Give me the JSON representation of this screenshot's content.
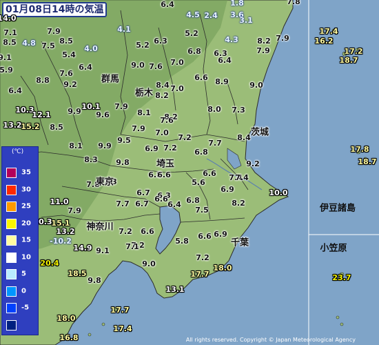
{
  "title": "01月08日14時の気温",
  "copyright": "All rights reserved. Copyright © Japan Meteorological Agency",
  "colors": {
    "sea": "#7fa4c8",
    "land": "#9bbd78",
    "mountain": "#6f9a55",
    "boundary": "#2b2b2b",
    "legend_bg": "#2f3fbf"
  },
  "prefectures": [
    "群馬",
    "栃木",
    "茨城",
    "埼玉",
    "東京",
    "千葉",
    "神奈川"
  ],
  "islands": [
    "伊豆諸島",
    "小笠原"
  ],
  "legend": {
    "unit": "(℃)",
    "items": [
      {
        "label": "35",
        "color": "#b4005a"
      },
      {
        "label": "30",
        "color": "#ff2800"
      },
      {
        "label": "25",
        "color": "#ff9900"
      },
      {
        "label": "20",
        "color": "#faf500"
      },
      {
        "label": "15",
        "color": "#fffaa0"
      },
      {
        "label": "10",
        "color": "#ffffff"
      },
      {
        "label": "5",
        "color": "#b9ebff"
      },
      {
        "label": "0",
        "color": "#0096ff"
      },
      {
        "label": "-5",
        "color": "#0041ff"
      },
      {
        "label": "",
        "color": "#002080"
      }
    ]
  },
  "temps": [
    [
      "14.0"
    ],
    [
      "7.9"
    ],
    [
      "8.5"
    ],
    [
      "6.4"
    ],
    [
      "4.5"
    ],
    [
      "2.4"
    ],
    [
      "1.8"
    ],
    [
      "3.6"
    ],
    [
      "3.1"
    ],
    [
      "7.8"
    ],
    [
      "7.1"
    ],
    [
      "4.1"
    ],
    [
      "6.3"
    ],
    [
      "8.5"
    ],
    [
      "4.8"
    ],
    [
      "7.5"
    ],
    [
      "5.2"
    ],
    [
      "5.2"
    ],
    [
      "6.3"
    ],
    [
      "17.4"
    ],
    [
      "16.2"
    ],
    [
      "7.9"
    ],
    [
      "5.4"
    ],
    [
      "4.0"
    ],
    [
      "6.8"
    ],
    [
      "4.3"
    ],
    [
      "8.2"
    ],
    [
      "7.9"
    ],
    [
      "6.4"
    ],
    [
      "17.2"
    ],
    [
      "18.7"
    ],
    [
      "9.1"
    ],
    [
      "9.0"
    ],
    [
      "7.6"
    ],
    [
      "7.0"
    ],
    [
      "6.4"
    ],
    [
      "5.9"
    ],
    [
      "7.6"
    ],
    [
      "9.2"
    ],
    [
      "8.8"
    ],
    [
      "8.4"
    ],
    [
      "6.6"
    ],
    [
      "8.9"
    ],
    [
      "9.0"
    ],
    [
      "6.4"
    ],
    [
      "7.0"
    ],
    [
      "8.2"
    ],
    [
      "10.3"
    ],
    [
      "10.1"
    ],
    [
      "7.9"
    ],
    [
      "9.9"
    ],
    [
      "12.1"
    ],
    [
      "9.6"
    ],
    [
      "8.1"
    ],
    [
      "8.2"
    ],
    [
      "8.0"
    ],
    [
      "7.3"
    ],
    [
      "13.2"
    ],
    [
      "15.2"
    ],
    [
      "8.5"
    ],
    [
      "7.9"
    ],
    [
      "7.6"
    ],
    [
      "7.0"
    ],
    [
      "7.2"
    ],
    [
      "8.4"
    ],
    [
      "8.1"
    ],
    [
      "9.9"
    ],
    [
      "9.5"
    ],
    [
      "7.2"
    ],
    [
      "7.7"
    ],
    [
      "6.9"
    ],
    [
      "6.8"
    ],
    [
      "17.8"
    ],
    [
      "18.7"
    ],
    [
      "8.3"
    ],
    [
      "9.8"
    ],
    [
      "7.8"
    ],
    [
      "9.2"
    ],
    [
      "6.8"
    ],
    [
      "6.6"
    ],
    [
      "6.6"
    ],
    [
      "7.4"
    ],
    [
      "7.4"
    ],
    [
      "7.3"
    ],
    [
      "5.6"
    ],
    [
      "6.9"
    ],
    [
      "10.0"
    ],
    [
      "11.0"
    ],
    [
      "6.7"
    ],
    [
      "6.3"
    ],
    [
      "6.7"
    ],
    [
      "6.8"
    ],
    [
      "6.6"
    ],
    [
      "6.4"
    ],
    [
      "8.2"
    ],
    [
      "7.9"
    ],
    [
      "7.7"
    ],
    [
      "10.3"
    ],
    [
      "15.1"
    ],
    [
      "7.5"
    ],
    [
      "13.2"
    ],
    [
      "7.2"
    ],
    [
      "6.6"
    ],
    [
      "6.9"
    ],
    [
      "7.2"
    ],
    [
      "-10.2"
    ],
    [
      "14.9"
    ],
    [
      "5.8"
    ],
    [
      "6.6"
    ],
    [
      "9.1"
    ],
    [
      "7.1"
    ],
    [
      "20.4"
    ],
    [
      "9.0"
    ],
    [
      "7.2"
    ],
    [
      "18.5"
    ],
    [
      "18.0"
    ],
    [
      "17.7"
    ],
    [
      "23.7"
    ],
    [
      "9.8"
    ],
    [
      "13.1"
    ],
    [
      "17.7"
    ],
    [
      "17.4"
    ],
    [
      "18.0"
    ],
    [
      "16.8"
    ]
  ]
}
